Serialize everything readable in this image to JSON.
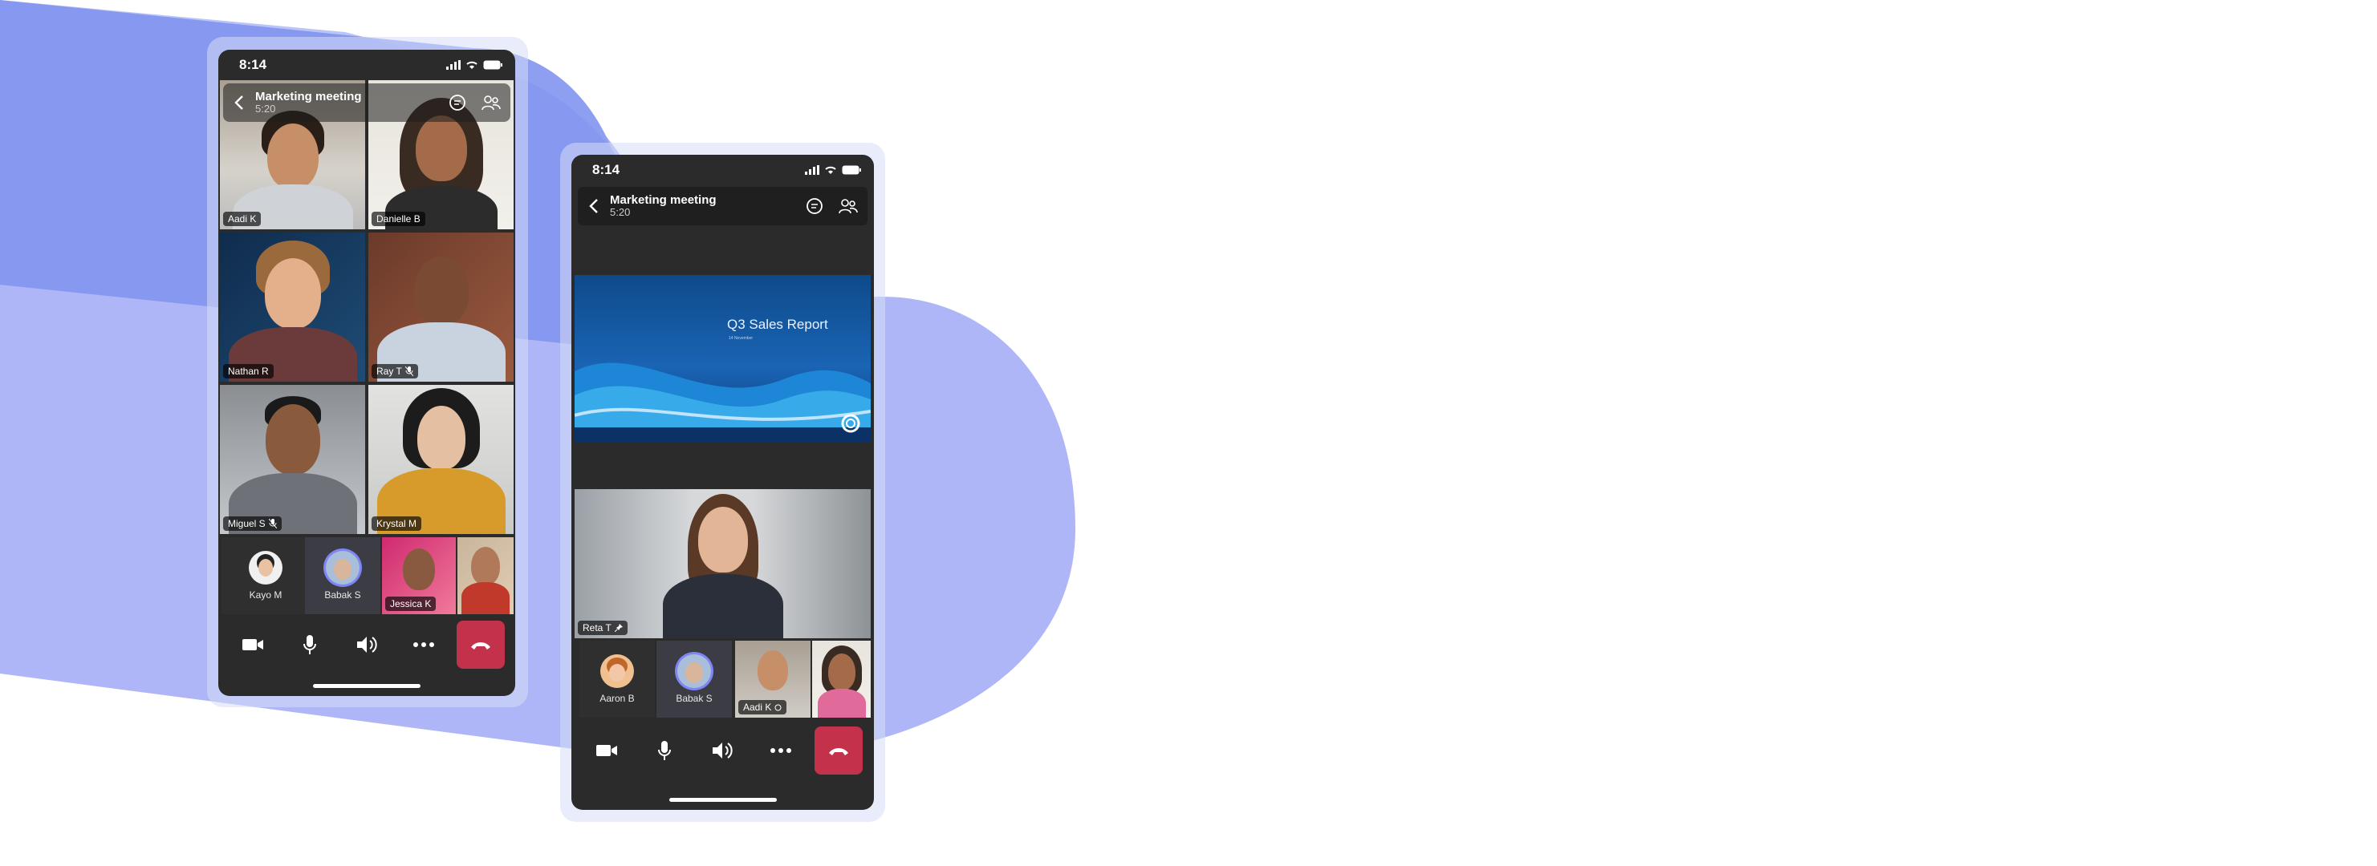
{
  "colors": {
    "background_blob_dark": "#8c9cf0",
    "background_blob_light": "#adb6f5",
    "phone_body": "#2b2b2b",
    "end_call": "#c4314b"
  },
  "phone1": {
    "status_time": "8:14",
    "meeting_title": "Marketing meeting",
    "meeting_time": "5:20",
    "participants": [
      {
        "name": "Aadi K"
      },
      {
        "name": "Danielle B"
      },
      {
        "name": "Nathan R"
      },
      {
        "name": "Ray T"
      },
      {
        "name": "Miguel S"
      },
      {
        "name": "Krystal M"
      }
    ],
    "strip": [
      {
        "name": "Kayo M"
      },
      {
        "name": "Babak S"
      },
      {
        "name": "Jessica K"
      }
    ],
    "controls": [
      "video-icon",
      "microphone-icon",
      "speaker-icon",
      "more-icon",
      "end-call-icon"
    ]
  },
  "phone2": {
    "status_time": "8:14",
    "meeting_title": "Marketing meeting",
    "meeting_time": "5:20",
    "slide": {
      "title": "Q3 Sales Report",
      "subtitle": "14 November"
    },
    "featured": {
      "name": "Reta T"
    },
    "strip": [
      {
        "name": "Aaron B"
      },
      {
        "name": "Babak S"
      },
      {
        "name": "Aadi K"
      }
    ],
    "controls": [
      "video-icon",
      "microphone-icon",
      "speaker-icon",
      "more-icon",
      "end-call-icon"
    ]
  }
}
